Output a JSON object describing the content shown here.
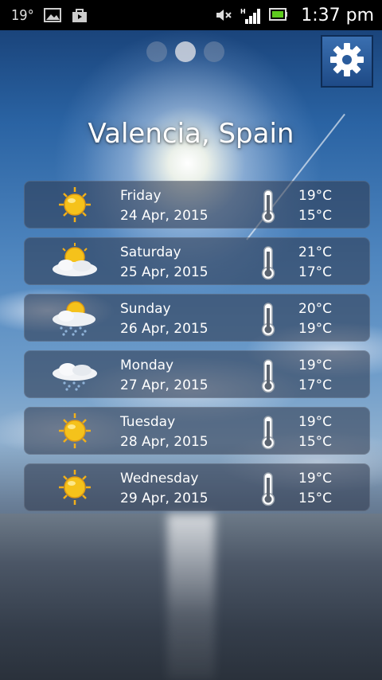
{
  "status_bar": {
    "temperature": "19°",
    "time": "1:37 pm",
    "network": "H"
  },
  "location": {
    "city": "Valencia, Spain"
  },
  "pager": {
    "count": 3,
    "active_index": 1
  },
  "forecast": [
    {
      "day": "Friday",
      "date": "24 Apr, 2015",
      "high": "19°C",
      "low": "15°C",
      "condition_icon": "sunny-icon"
    },
    {
      "day": "Saturday",
      "date": "25 Apr, 2015",
      "high": "21°C",
      "low": "17°C",
      "condition_icon": "partly-cloudy-icon"
    },
    {
      "day": "Sunday",
      "date": "26 Apr, 2015",
      "high": "20°C",
      "low": "19°C",
      "condition_icon": "sun-cloud-rain-icon"
    },
    {
      "day": "Monday",
      "date": "27 Apr, 2015",
      "high": "19°C",
      "low": "17°C",
      "condition_icon": "cloud-rain-icon"
    },
    {
      "day": "Tuesday",
      "date": "28 Apr, 2015",
      "high": "19°C",
      "low": "15°C",
      "condition_icon": "sunny-icon"
    },
    {
      "day": "Wednesday",
      "date": "29 Apr, 2015",
      "high": "19°C",
      "low": "15°C",
      "condition_icon": "sunny-icon"
    }
  ],
  "colors": {
    "sun": "#f5c21b",
    "card_bg": "#2d374b",
    "settings_bg": "#2a5c9c"
  }
}
